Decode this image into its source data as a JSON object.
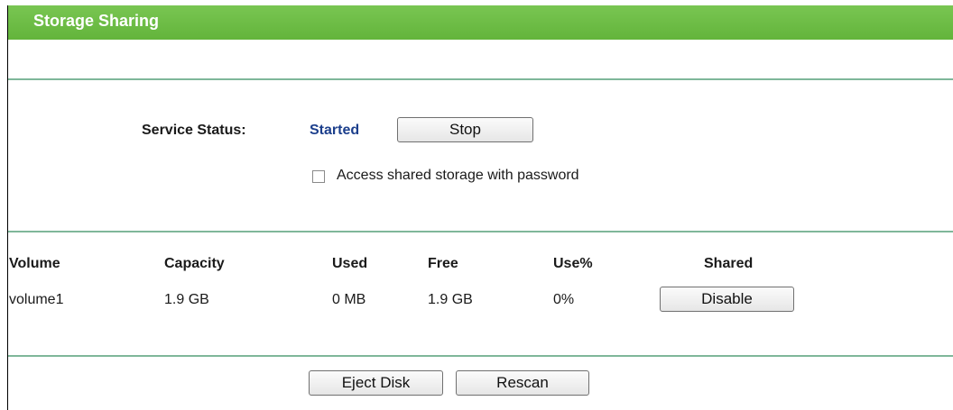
{
  "header": {
    "title": "Storage Sharing"
  },
  "service": {
    "status_label": "Service Status:",
    "status_value": "Started",
    "stop_label": "Stop",
    "password_checkbox_label": "Access shared storage with password",
    "password_checked": false
  },
  "table": {
    "headers": [
      "Volume",
      "Capacity",
      "Used",
      "Free",
      "Use%",
      "Shared"
    ],
    "rows": [
      {
        "volume": "volume1",
        "capacity": "1.9 GB",
        "used": "0 MB",
        "free": "1.9 GB",
        "use_pct": "0%",
        "shared_action": "Disable"
      }
    ]
  },
  "footer": {
    "eject_label": "Eject Disk",
    "rescan_label": "Rescan"
  },
  "colors": {
    "title_bar": "#6dbd46",
    "status_value": "#1c3f8c",
    "divider": "#7fb79a"
  }
}
